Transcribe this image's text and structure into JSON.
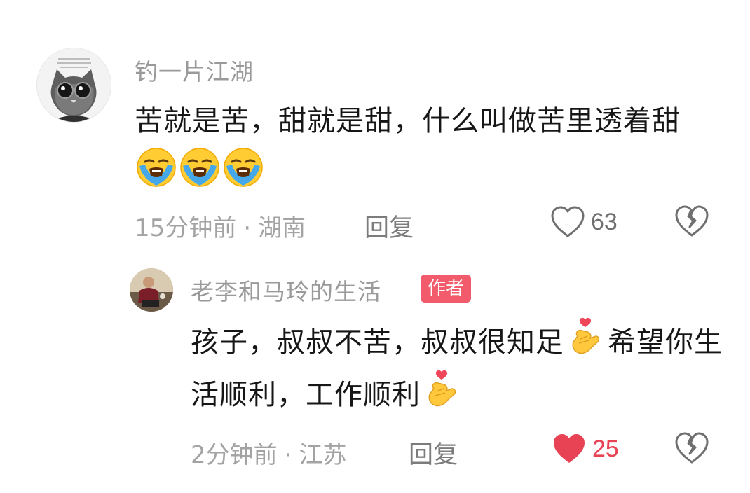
{
  "comment": {
    "username": "钓一片江湖",
    "text": "苦就是苦，甜就是甜，什么叫做苦里透着甜",
    "emojis": [
      "loudly-crying-face",
      "loudly-crying-face",
      "loudly-crying-face"
    ],
    "time": "15分钟前",
    "location": "湖南",
    "reply_label": "回复",
    "likes": "63",
    "liked": false
  },
  "reply": {
    "username": "老李和马玲的生活",
    "badge": "作者",
    "text_part1": "孩子，叔叔不苦，叔叔很知足",
    "text_part2": "希望你生活顺利，工作顺利",
    "emojis": [
      "finger-heart",
      "finger-heart"
    ],
    "time": "2分钟前",
    "location": "江苏",
    "reply_label": "回复",
    "likes": "25",
    "liked": true
  },
  "colors": {
    "liked_heart": "#e84355",
    "badge_bg": "#f25b6b",
    "secondary_text": "#a3a3a3"
  }
}
